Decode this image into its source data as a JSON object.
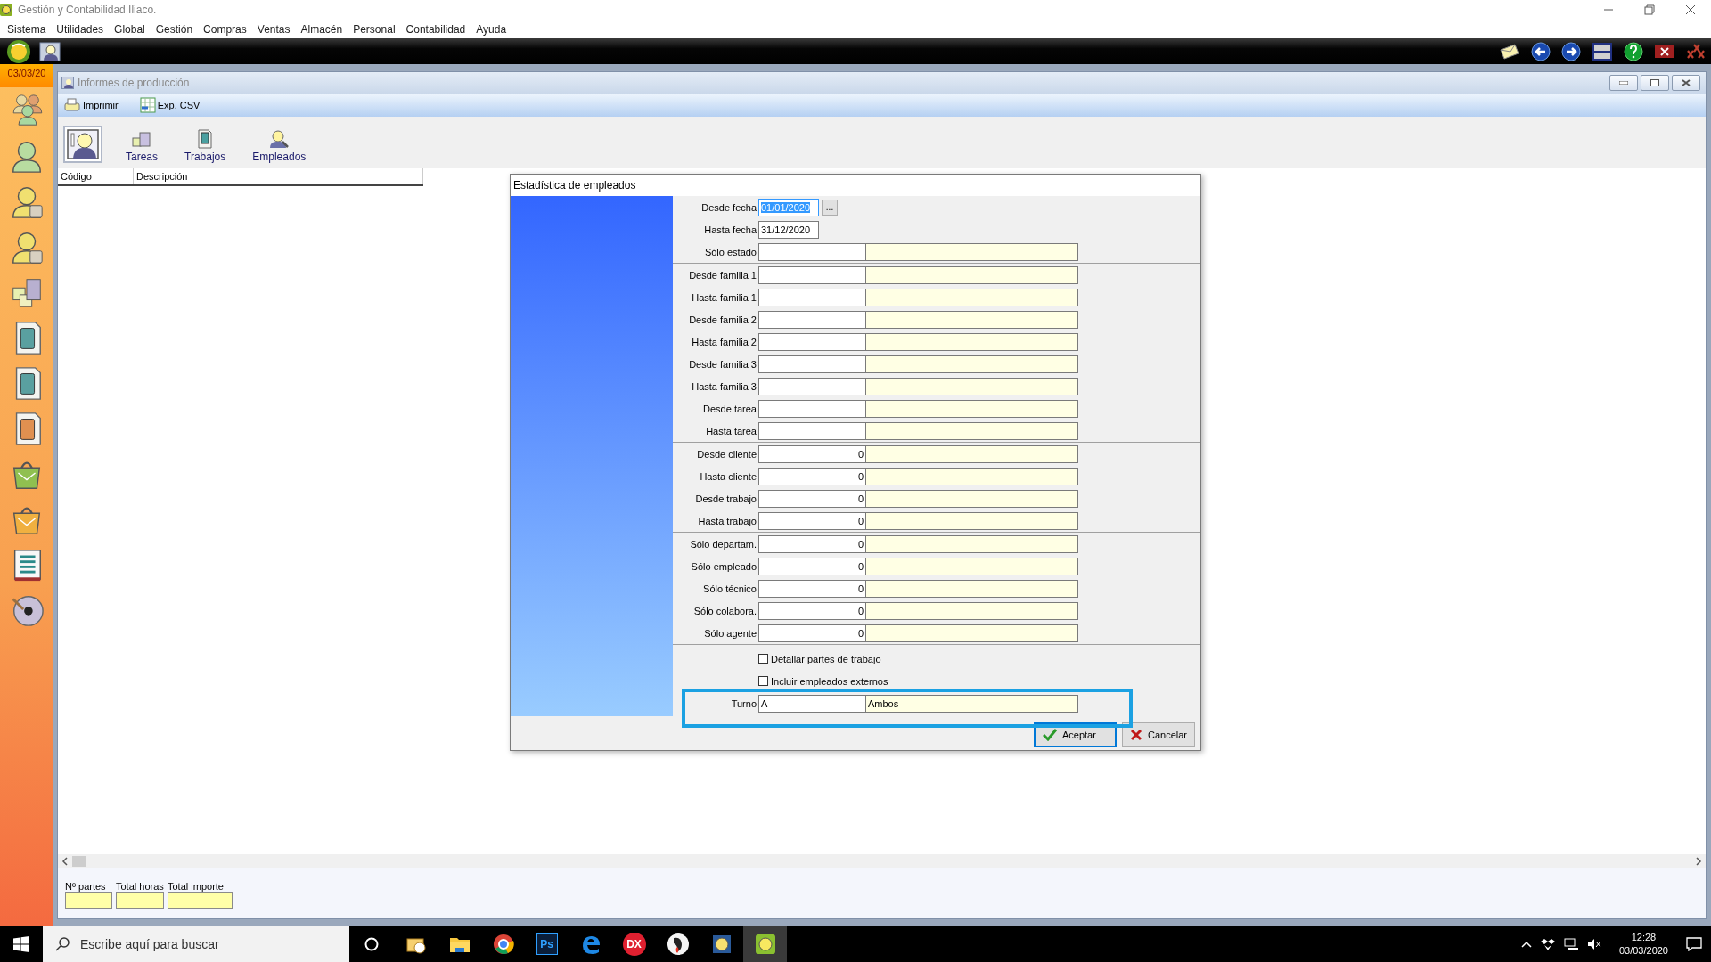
{
  "window": {
    "title": "Gestión y Contabilidad Iliaco.",
    "menu": [
      "Sistema",
      "Utilidades",
      "Global",
      "Gestión",
      "Compras",
      "Ventas",
      "Almacén",
      "Personal",
      "Contabilidad",
      "Ayuda"
    ]
  },
  "sidebar": {
    "date": "03/03/20"
  },
  "child_window": {
    "title": "Informes de producción",
    "toolbar": [
      {
        "kind": "printer",
        "label": "Imprimir"
      },
      {
        "kind": "csv",
        "label": "Exp. CSV"
      }
    ],
    "views": [
      {
        "kind": "report",
        "selected": true
      },
      {
        "kind": "tasks",
        "label": "Tareas",
        "selected": false
      },
      {
        "kind": "jobs",
        "label": "Trabajos",
        "selected": false
      },
      {
        "kind": "employees",
        "label": "Empleados",
        "selected": false
      }
    ],
    "table": {
      "columns": [
        "Código",
        "Descripción"
      ]
    },
    "totals": [
      {
        "label": "Nº partes"
      },
      {
        "label": "Total horas"
      },
      {
        "label": "Total importe"
      }
    ]
  },
  "dialog": {
    "title": "Estadística de empleados",
    "sections": [
      {
        "rows": [
          {
            "kind": "date",
            "label": "Desde fecha",
            "value": "01/01/2020",
            "focused": true,
            "picker": "..."
          },
          {
            "kind": "date",
            "label": "Hasta fecha",
            "value": "31/12/2020",
            "focused": false
          },
          {
            "kind": "lookup",
            "label": "Sólo estado"
          }
        ]
      },
      {
        "rows": [
          {
            "kind": "lookup",
            "label": "Desde familia 1"
          },
          {
            "kind": "lookup",
            "label": "Hasta familia 1"
          },
          {
            "kind": "lookup",
            "label": "Desde familia 2"
          },
          {
            "kind": "lookup",
            "label": "Hasta familia 2"
          },
          {
            "kind": "lookup",
            "label": "Desde familia 3"
          },
          {
            "kind": "lookup",
            "label": "Hasta familia 3"
          },
          {
            "kind": "lookup",
            "label": "Desde tarea"
          },
          {
            "kind": "lookup",
            "label": "Hasta tarea"
          }
        ]
      },
      {
        "rows": [
          {
            "kind": "numeric",
            "label": "Desde cliente",
            "value": "0"
          },
          {
            "kind": "numeric",
            "label": "Hasta cliente",
            "value": "0"
          },
          {
            "kind": "numeric",
            "label": "Desde trabajo",
            "value": "0"
          },
          {
            "kind": "numeric",
            "label": "Hasta trabajo",
            "value": "0"
          }
        ]
      },
      {
        "rows": [
          {
            "kind": "numeric",
            "label": "Sólo departam.",
            "value": "0"
          },
          {
            "kind": "numeric",
            "label": "Sólo empleado",
            "value": "0"
          },
          {
            "kind": "numeric",
            "label": "Sólo técnico",
            "value": "0"
          },
          {
            "kind": "numeric",
            "label": "Sólo colabora.",
            "value": "0"
          },
          {
            "kind": "numeric",
            "label": "Sólo agente",
            "value": "0"
          }
        ]
      }
    ],
    "checkboxes": [
      {
        "label": "Detallar partes de trabajo",
        "checked": false
      },
      {
        "label": "Incluir empleados externos",
        "checked": false
      }
    ],
    "turno": {
      "label": "Turno",
      "value": "A",
      "description": "Ambos"
    },
    "annotation": {
      "kind": "frame"
    },
    "buttons": [
      {
        "kind": "ok",
        "label": "Aceptar",
        "focused": true
      },
      {
        "kind": "cancel",
        "label": "Cancelar",
        "focused": false
      }
    ]
  },
  "taskbar": {
    "search": {
      "placeholder": "Escribe aquí para buscar"
    },
    "apps": [
      {
        "kind": "mail",
        "selected": false
      },
      {
        "kind": "folder",
        "selected": false
      },
      {
        "kind": "chrome",
        "selected": false
      },
      {
        "kind": "photoshop",
        "label": "Ps",
        "selected": false
      },
      {
        "kind": "edge",
        "selected": false
      },
      {
        "kind": "dx",
        "label": "DX",
        "selected": false
      },
      {
        "kind": "bird",
        "selected": false
      },
      {
        "kind": "ledger",
        "selected": false
      },
      {
        "kind": "gestion",
        "selected": true
      }
    ],
    "time": "12:28",
    "date": "03/03/2020"
  }
}
